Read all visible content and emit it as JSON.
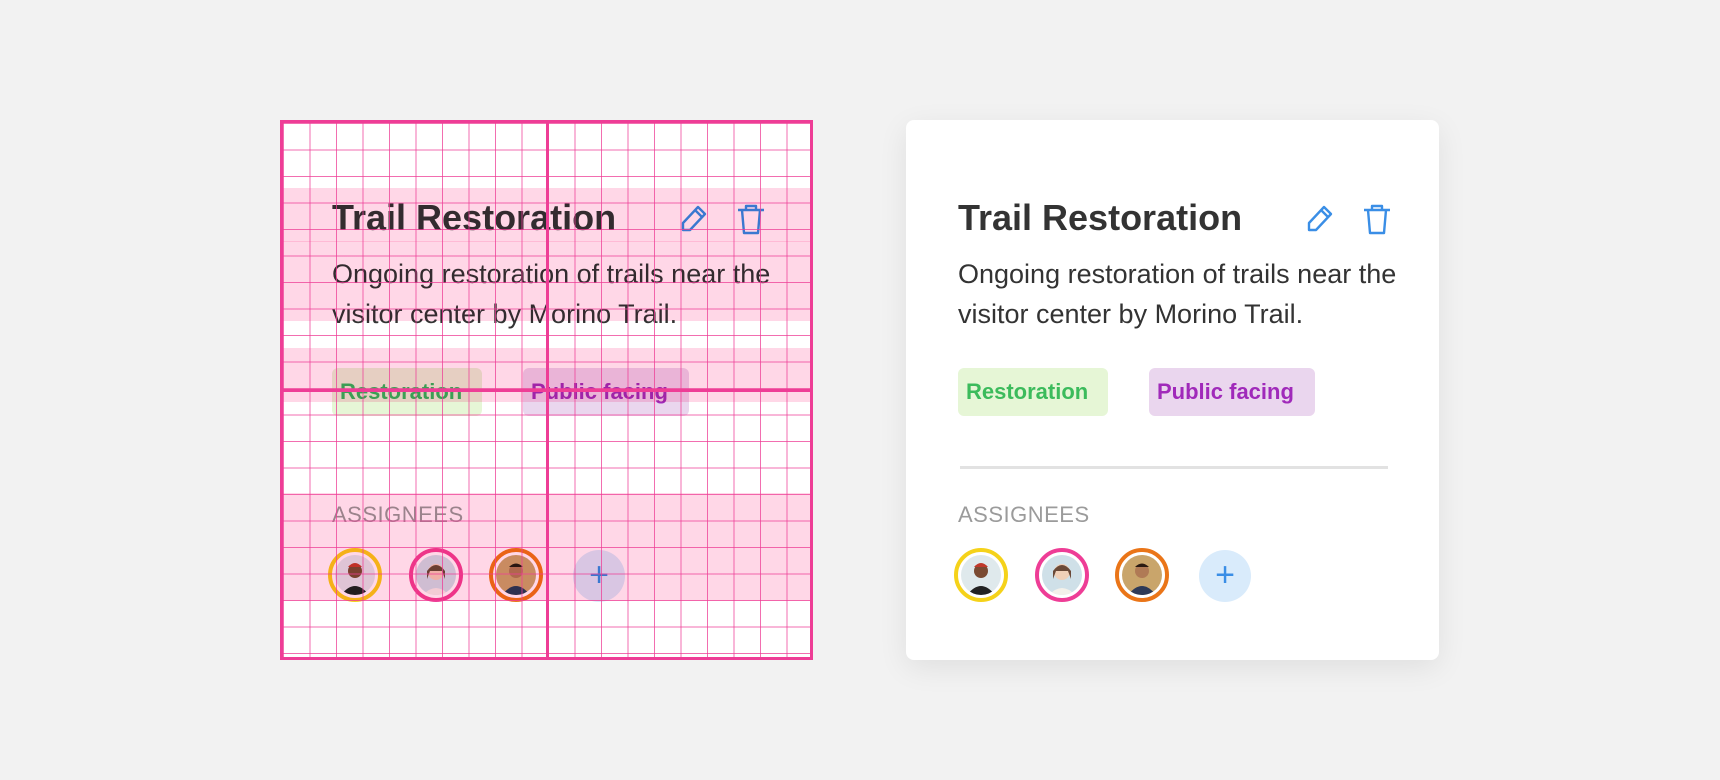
{
  "card": {
    "title": "Trail Restoration",
    "description": "Ongoing restoration of trails near the visitor center by Morino Trail.",
    "tags": [
      "Restoration",
      "Public facing"
    ],
    "assignees_label": "ASSIGNEES",
    "add_label": "+",
    "icons": [
      "pencil-icon",
      "trash-icon",
      "plus-icon"
    ]
  },
  "colors": {
    "background": "#f2f2f2",
    "card": "#ffffff",
    "grid_overlay": "#ee3d96",
    "icon_blue": "#3a8ee6",
    "tag_restoration_bg": "#e6f6d6",
    "tag_restoration_text": "#3cbb5c",
    "tag_public_bg": "#ead6ee",
    "tag_public_text": "#a02aba",
    "avatar_rings": [
      "#f5d21a",
      "#ee3d96",
      "#ea7518"
    ]
  }
}
